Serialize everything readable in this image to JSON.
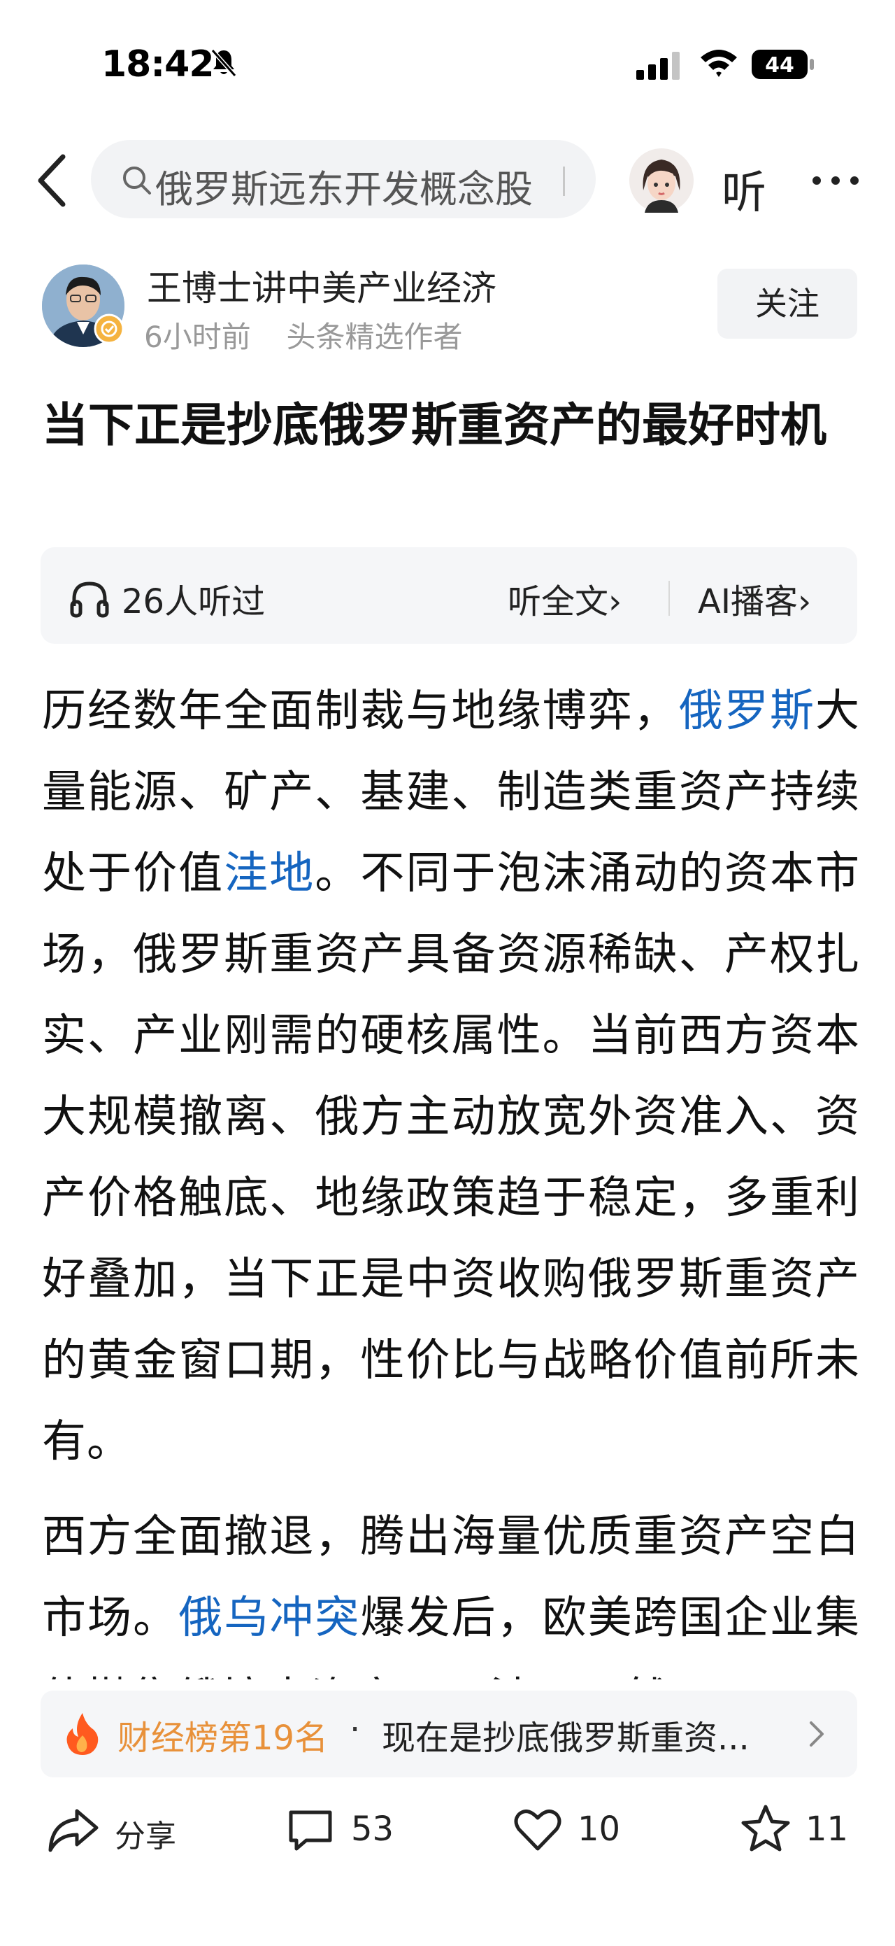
{
  "status_bar": {
    "time": "18:42",
    "battery": "44"
  },
  "nav": {
    "search_text": "俄罗斯远东开发概念股",
    "listen_label": "听"
  },
  "author": {
    "name": "王博士讲中美产业经济",
    "time_ago": "6小时前",
    "tag": "头条精选作者",
    "follow_label": "关注"
  },
  "article": {
    "title": "当下正是抄底俄罗斯重资产的最好时机",
    "audio": {
      "listeners": "26人听过",
      "full_text": "听全文›",
      "ai_cast": "AI播客›"
    },
    "p1": {
      "a": "历经数年全面制裁与地缘博弈，",
      "link1": "俄罗斯",
      "b": "大量能源、矿产、基建、制造类重资产持续处于价值",
      "link2": "洼地",
      "c": "。不同于泡沫涌动的资本市场，俄罗斯重资产具备资源稀缺、产权扎实、产业刚需的硬核属性。当前西方资本大规模撤离、俄方主动放宽外资准入、资产价格触底、地缘政策趋于稳定，多重利好叠加，当下正是中资收购俄罗斯重资产的黄金窗口期，性价比与战略价值前所未有。"
    },
    "p2": {
      "a": "西方全面撤退，腾出海量优质重资产空白市场。",
      "link1": "俄乌冲突",
      "b": "爆发后，欧美跨国企业集体抛售俄境内资产，石油、天然"
    }
  },
  "rank": {
    "label": "财经榜第19名",
    "dot": "·",
    "text": "现在是抄底俄罗斯重资..."
  },
  "actions": {
    "share_label": "分享",
    "comments": "53",
    "likes": "10",
    "favorites": "11"
  },
  "colors": {
    "link": "#1565c0",
    "rank": "#e8913a",
    "flame": "#ff5a1f"
  }
}
